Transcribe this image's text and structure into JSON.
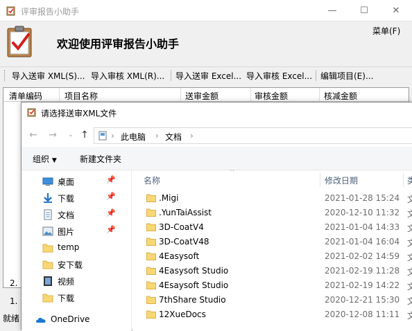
{
  "main_window": {
    "title": "评审报告小助手",
    "welcome": "欢迎使用评审报告小助手",
    "menu_label": "菜单(F)",
    "toolbar": [
      "导入送审 XML(S)...",
      "导入审核 XML(R)...",
      "导入送审 Excel...",
      "导入审核 Excel...",
      "编辑项目(E)..."
    ],
    "table_headers": [
      "清单编码",
      "项目名称",
      "送审金额",
      "审核金额",
      "核减金额"
    ],
    "left_marks": [
      "2.",
      "1."
    ],
    "status": "就绪",
    "window_buttons": [
      "—",
      "☐",
      "✕"
    ]
  },
  "dialog": {
    "title": "请选择送审XML文件",
    "breadcrumb": [
      "此电脑",
      "文档"
    ],
    "commands": {
      "organize": "组织",
      "new_folder": "新建文件夹"
    },
    "nav_items": [
      {
        "label": "桌面",
        "icon": "desktop-icon",
        "pinned": true
      },
      {
        "label": "下载",
        "icon": "download-icon",
        "pinned": true
      },
      {
        "label": "文档",
        "icon": "document-icon",
        "pinned": true
      },
      {
        "label": "图片",
        "icon": "picture-icon",
        "pinned": true
      },
      {
        "label": "temp",
        "icon": "folder-icon",
        "pinned": false
      },
      {
        "label": "安下载",
        "icon": "folder-icon",
        "pinned": false
      },
      {
        "label": "视频",
        "icon": "video-icon",
        "pinned": false
      },
      {
        "label": "下载",
        "icon": "folder-icon",
        "pinned": false
      },
      {
        "label": "OneDrive",
        "icon": "onedrive-icon",
        "pinned": false
      }
    ],
    "columns": {
      "name": "名称",
      "date": "修改日期",
      "type": "类"
    },
    "files": [
      {
        "name": ".Migi",
        "date": "2021-01-28 15:24",
        "type": "文"
      },
      {
        "name": ".YunTaiAssist",
        "date": "2020-12-10 11:32",
        "type": "文"
      },
      {
        "name": "3D-CoatV4",
        "date": "2021-01-04 14:33",
        "type": "文"
      },
      {
        "name": "3D-CoatV48",
        "date": "2021-01-04 16:04",
        "type": "文"
      },
      {
        "name": "4Easysoft",
        "date": "2021-02-02 14:59",
        "type": "文"
      },
      {
        "name": "4Easysoft Studio",
        "date": "2021-02-19 11:28",
        "type": "文"
      },
      {
        "name": "4Esaysoft Studio",
        "date": "2021-02-19 14:22",
        "type": "文"
      },
      {
        "name": "7thShare Studio",
        "date": "2020-12-21 15:30",
        "type": "文"
      },
      {
        "name": "12XueDocs",
        "date": "2020-12-08 11:11",
        "type": "文"
      }
    ]
  }
}
